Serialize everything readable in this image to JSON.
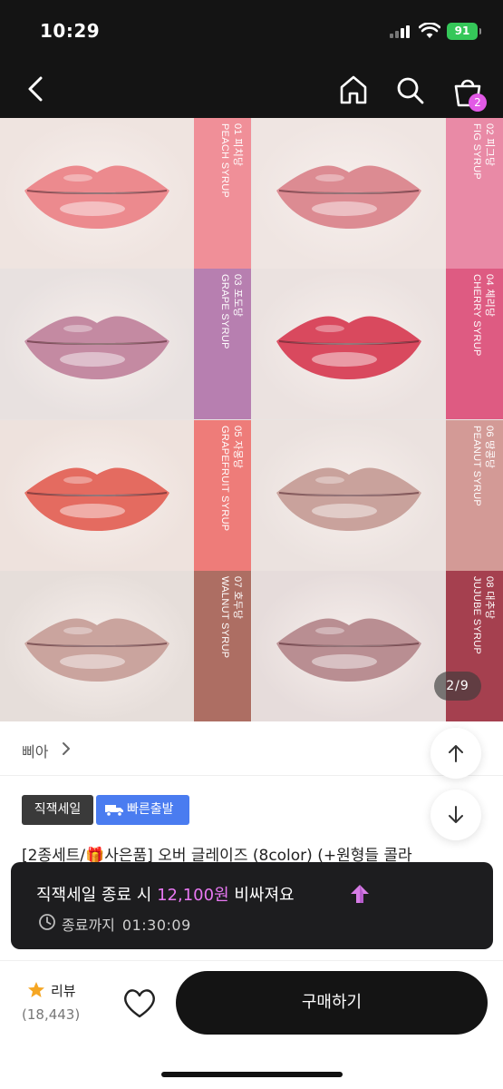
{
  "status_bar": {
    "time": "10:29",
    "battery": "91"
  },
  "nav": {
    "back_icon": "chevron-left-icon",
    "home_icon": "home-icon",
    "search_icon": "search-icon",
    "cart_icon": "shopping-bag-icon",
    "cart_badge": "2"
  },
  "gallery": {
    "counter": "2/9",
    "swatches": [
      {
        "number": "01 피치당",
        "name": "PEACH SYRUP",
        "strip_color": "#f08f98",
        "lip_color": "#ec8a8e",
        "skin": "#efe4e0"
      },
      {
        "number": "02 피그당",
        "name": "FIG SYRUP",
        "strip_color": "#e98aa6",
        "lip_color": "#dc8b92",
        "skin": "#efe5e2"
      },
      {
        "number": "03 포도당",
        "name": "GRAPE SYRUP",
        "strip_color": "#b77fb0",
        "lip_color": "#c48aa2",
        "skin": "#e8e1e0"
      },
      {
        "number": "04 체리당",
        "name": "CHERRY SYRUP",
        "strip_color": "#de5b82",
        "lip_color": "#d9495e",
        "skin": "#ebe2e0"
      },
      {
        "number": "05 자몽당",
        "name": "GRAPEFRUIT SYRUP",
        "strip_color": "#ee7c79",
        "lip_color": "#e46b60",
        "skin": "#eee2dd"
      },
      {
        "number": "06 땅콩당",
        "name": "PEANUT SYRUP",
        "strip_color": "#d39a96",
        "lip_color": "#c9a29c",
        "skin": "#ebe2df"
      },
      {
        "number": "07 호두당",
        "name": "WALNUT SYRUP",
        "strip_color": "#ad6e63",
        "lip_color": "#caa49e",
        "skin": "#e6deda"
      },
      {
        "number": "08 대추당",
        "name": "JUJUBE SYRUP",
        "strip_color": "#a5404f",
        "lip_color": "#b98e92",
        "skin": "#e6dcdb"
      }
    ]
  },
  "brand": {
    "name": "삐아",
    "chevron_icon": "chevron-right-icon"
  },
  "scroll": {
    "up_icon": "arrow-up-icon",
    "down_icon": "arrow-down-icon"
  },
  "badges": {
    "sale": "직잭세일",
    "fast": "빠른출발",
    "fast_icon": "truck-icon"
  },
  "product": {
    "title": "[2종세트/🎁사은품] 오버 글레이즈 (8color) (+원형들 콜라"
  },
  "toast": {
    "line1_prefix": "직잭세일 종료 시 ",
    "line1_price": "12,100원",
    "line1_suffix": " 비싸져요",
    "arrow_icon": "arrow-up-gem-icon",
    "clock_icon": "clock-icon",
    "countdown_label": "종료까지",
    "countdown": "01:30:09"
  },
  "bottom": {
    "review_icon": "star-icon",
    "review_label": "리뷰",
    "review_count": "(18,443)",
    "wish_icon": "heart-icon",
    "buy_label": "구매하기"
  },
  "colors": {
    "accent": "#e878f2",
    "dark": "#141414",
    "fast_badge": "#4a7cf0"
  }
}
